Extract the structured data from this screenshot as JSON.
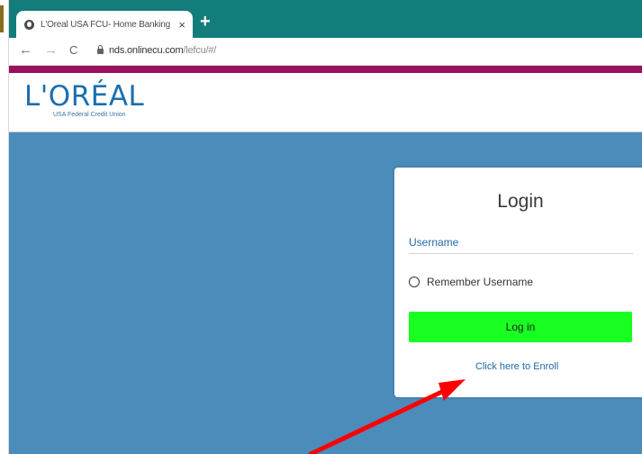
{
  "browser": {
    "tab_title": "L'Oreal USA FCU- Home Banking",
    "tab_close": "×",
    "new_tab": "+",
    "nav": {
      "back": "←",
      "forward": "→",
      "reload": "C"
    },
    "url_host": "nds.onlinecu.com",
    "url_path": "/lefcu/#/"
  },
  "site": {
    "logo": "L'ORÉAL",
    "logo_subtitle": "USA Federal Credit Union"
  },
  "login": {
    "title": "Login",
    "username_placeholder": "Username",
    "remember_label": "Remember Username",
    "remember_checked": false,
    "login_button": "Log in",
    "enroll_link": "Click here to Enroll"
  },
  "colors": {
    "tab_strip": "#137d7c",
    "accent_bar": "#9a0f5e",
    "page_background": "#4b8cbb",
    "login_button": "#1aff22",
    "brand_blue": "#1b6fae",
    "annotation_arrow": "#ff0000"
  },
  "icons": [
    "globe-icon",
    "close-icon",
    "plus-icon",
    "back-arrow-icon",
    "forward-arrow-icon",
    "reload-icon",
    "lock-icon",
    "radio-icon",
    "annotation-arrow"
  ]
}
